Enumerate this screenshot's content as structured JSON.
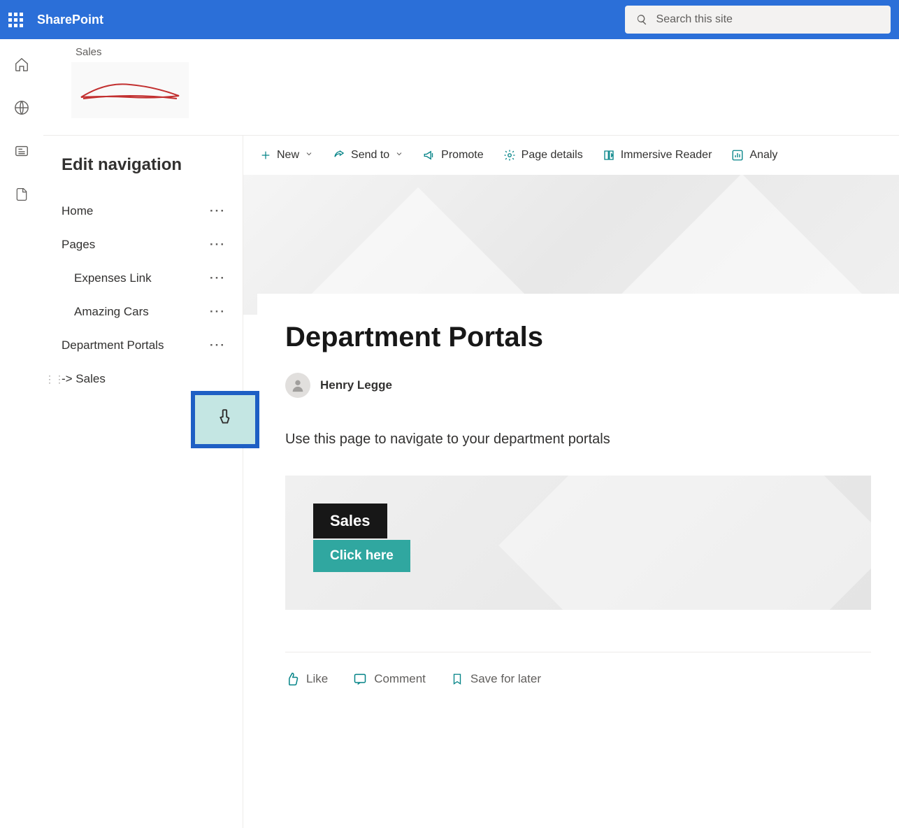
{
  "header": {
    "brand": "SharePoint",
    "search_placeholder": "Search this site"
  },
  "site": {
    "parent_link": "Sales"
  },
  "edit_nav": {
    "title": "Edit navigation",
    "items": [
      {
        "label": "Home",
        "indent": 0
      },
      {
        "label": "Pages",
        "indent": 0
      },
      {
        "label": "Expenses Link",
        "indent": 1
      },
      {
        "label": "Amazing Cars",
        "indent": 1
      },
      {
        "label": "Department Portals",
        "indent": 0
      },
      {
        "label": "-> Sales",
        "indent": 0
      }
    ]
  },
  "commands": {
    "new": "New",
    "send_to": "Send to",
    "promote": "Promote",
    "page_details": "Page details",
    "immersive_reader": "Immersive Reader",
    "analytics": "Analy"
  },
  "page": {
    "title": "Department Portals",
    "author": "Henry Legge",
    "intro": "Use this page to navigate to your department portals"
  },
  "hero_card": {
    "title": "Sales",
    "button": "Click here"
  },
  "actions": {
    "like": "Like",
    "comment": "Comment",
    "save": "Save for later"
  }
}
